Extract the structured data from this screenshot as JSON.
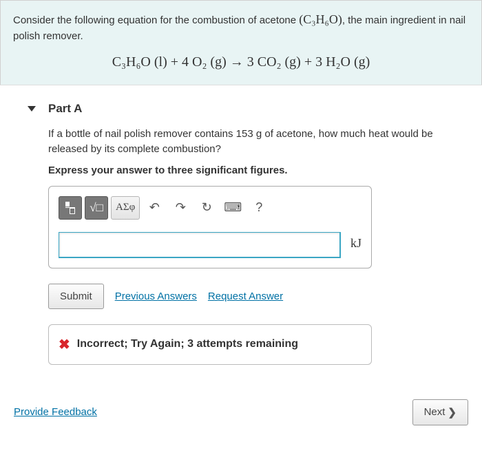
{
  "problem": {
    "intro_pre": "Consider the following equation for the combustion of acetone ",
    "formula": "(C₃H₆O)",
    "intro_post": ", the main ingredient in nail polish remover.",
    "equation": "C₃H₆O (l) + 4 O₂ (g) → 3 CO₂ (g) + 3 H₂O (g)"
  },
  "part": {
    "label": "Part A",
    "question": "If a bottle of nail polish remover contains 153 g of acetone, how much heat would be released by its complete combustion?",
    "instruction": "Express your answer to three significant figures.",
    "unit": "kJ"
  },
  "toolbar": {
    "greek": "ΑΣφ",
    "help": "?"
  },
  "actions": {
    "submit": "Submit",
    "previous": "Previous Answers",
    "request": "Request Answer"
  },
  "feedback": {
    "message": "Incorrect; Try Again; 3 attempts remaining"
  },
  "footer": {
    "provide_feedback": "Provide Feedback",
    "next": "Next"
  },
  "input": {
    "value": ""
  }
}
